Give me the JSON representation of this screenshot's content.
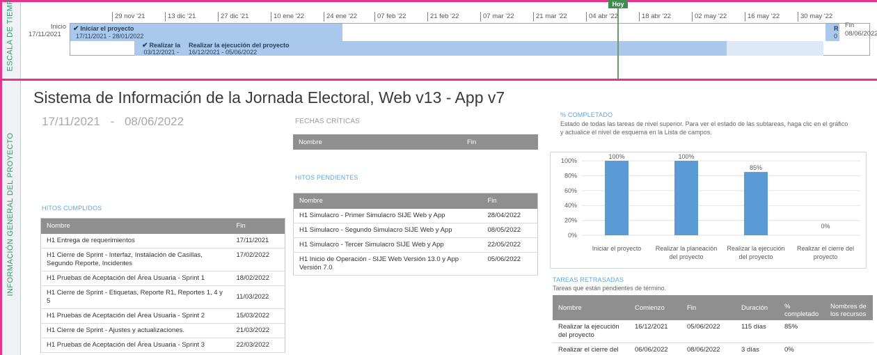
{
  "side_labels": {
    "timeline": "ESCALA DE TIEMPO",
    "info": "INFORMACIÓN GENERAL DEL PROYECTO"
  },
  "timeline": {
    "today_label": "Hoy",
    "start_label": "Inicio",
    "start_date": "17/11/2021",
    "end_label": "Fin",
    "end_date": "08/06/2022",
    "ticks": [
      "29 nov '21",
      "13 dic '21",
      "27 dic '21",
      "10 ene '22",
      "24 ene '22",
      "07 feb '22",
      "21 feb '22",
      "07 mar '22",
      "21 mar '22",
      "04 abr '22",
      "18 abr '22",
      "02 may '22",
      "16 may '22",
      "30 may '22"
    ],
    "bars": [
      {
        "title": "Iniciar el proyecto",
        "dates": "17/11/2021 - 28/01/2022"
      },
      {
        "title": "Realizar la",
        "dates": "03/12/2021 -"
      },
      {
        "title": "Realizar la ejecución del proyecto",
        "dates": "16/12/2021 - 05/06/2022"
      },
      {
        "title": "R",
        "dates": "0"
      }
    ]
  },
  "project": {
    "title": "Sistema de Información de la Jornada Electoral, Web v13 - App v7",
    "start": "17/11/2021",
    "separator": "-",
    "end": "08/06/2022"
  },
  "fechas_criticas": {
    "heading": "FECHAS CRÍTICAS",
    "columns": [
      "Nombre",
      "Fin"
    ]
  },
  "hitos_pendientes": {
    "heading": "HITOS PENDIENTES",
    "columns": [
      "Nombre",
      "Fin"
    ],
    "rows": [
      [
        "H1 Simulacro - Primer Simulacro SIJE Web y App",
        "28/04/2022"
      ],
      [
        "H1 Simulacro - Segundo Simulacro SIJE Web y App",
        "08/05/2022"
      ],
      [
        "H1 Simulacro - Tercer Simulacro SIJE Web y App",
        "22/05/2022"
      ],
      [
        "H1 Inicio de Operación - SIJE Web Versión 13.0 y App Versión 7.0",
        "05/06/2022"
      ]
    ]
  },
  "hitos_cumplidos": {
    "heading": "HITOS CUMPLIDOS",
    "columns": [
      "Nombre",
      "Fin"
    ],
    "rows": [
      [
        "H1 Entrega de requerimientos",
        "17/11/2021"
      ],
      [
        "H1 Cierre de Sprint - Interfaz, Instalación de Casillas, Segundo Reporte, Incidentes",
        "17/02/2022"
      ],
      [
        "H1 Pruebas de Aceptación del Área Usuaria - Sprint 1",
        "18/02/2022"
      ],
      [
        "H1 Cierre de Sprint - Etiquetas, Reporte R1, Reportes 1, 4 y 5",
        "11/03/2022"
      ],
      [
        "H1 Pruebas de Aceptación del Área Usuaria - Sprint 2",
        "15/03/2022"
      ],
      [
        "H1 Cierre de Sprint - Ajustes y actualizaciones.",
        "21/03/2022"
      ],
      [
        "H1 Pruebas de Aceptación del Área Usuaria - Sprint 3",
        "22/03/2022"
      ]
    ]
  },
  "completado": {
    "heading": "% COMPLETADO",
    "note": "Estado de todas las tareas de nivel superior. Para ver el estado de las subtareas, haga clic en el gráfico y actualice el nivel de esquema en la Lista de campos."
  },
  "chart_data": {
    "type": "bar",
    "categories": [
      "Iniciar el proyecto",
      "Realizar la planeación del proyecto",
      "Realizar la ejecución del proyecto",
      "Realizar el cierre del proyecto"
    ],
    "values": [
      100,
      100,
      85,
      0
    ],
    "data_labels": [
      "100%",
      "100%",
      "85%",
      "0%"
    ],
    "y_ticks": [
      "0%",
      "20%",
      "40%",
      "60%",
      "80%",
      "100%"
    ],
    "ylim": [
      0,
      100
    ],
    "bar_color": "#5b9bd5",
    "grid": true
  },
  "tareas_retrasadas": {
    "heading": "TAREAS RETRASADAS",
    "note": "Tareas que están pendientes de término.",
    "columns": [
      "Nombre",
      "Comienzo",
      "Fin",
      "Duración",
      "% completado",
      "Nombres de los recursos"
    ],
    "rows": [
      [
        "Realizar la ejecución del proyecto",
        "16/12/2021",
        "05/06/2022",
        "115 días",
        "85%",
        ""
      ],
      [
        "Realizar el cierre del",
        "06/06/2022",
        "08/06/2022",
        "3 días",
        "0%",
        ""
      ]
    ]
  }
}
